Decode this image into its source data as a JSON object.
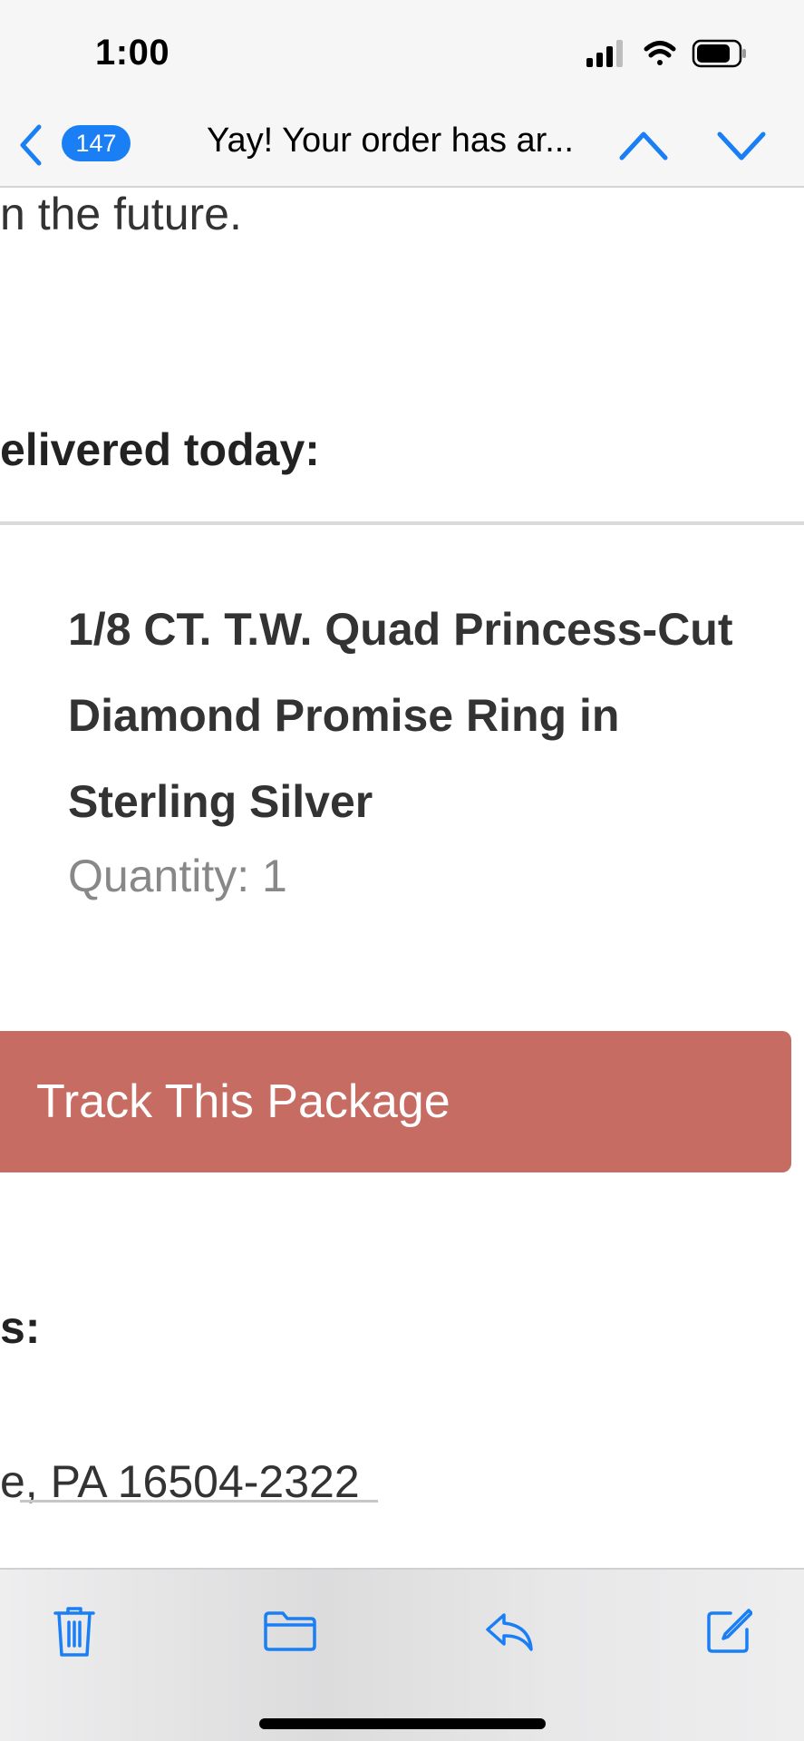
{
  "status_bar": {
    "time": "1:00"
  },
  "nav": {
    "unread_count": "147",
    "subject": "Yay! Your order has ar..."
  },
  "email": {
    "line_future": "n the future.",
    "line_delivered": "elivered today:",
    "product_name_lines": [
      "1/8 CT. T.W. Quad Princess-Cut",
      "Diamond Promise Ring in",
      "Sterling Silver"
    ],
    "quantity": "Quantity: 1",
    "track_button_label": "Track This Package",
    "line_s": "s:",
    "address_line": "e, PA 16504-2322"
  },
  "colors": {
    "accent": "#1a7ff5",
    "track_button": "#c66c63"
  },
  "icons": {
    "back": "chevron-left-icon",
    "previous": "chevron-up-icon",
    "next": "chevron-down-icon",
    "trash": "trash-icon",
    "folder": "folder-icon",
    "reply": "reply-icon",
    "compose": "compose-icon"
  }
}
